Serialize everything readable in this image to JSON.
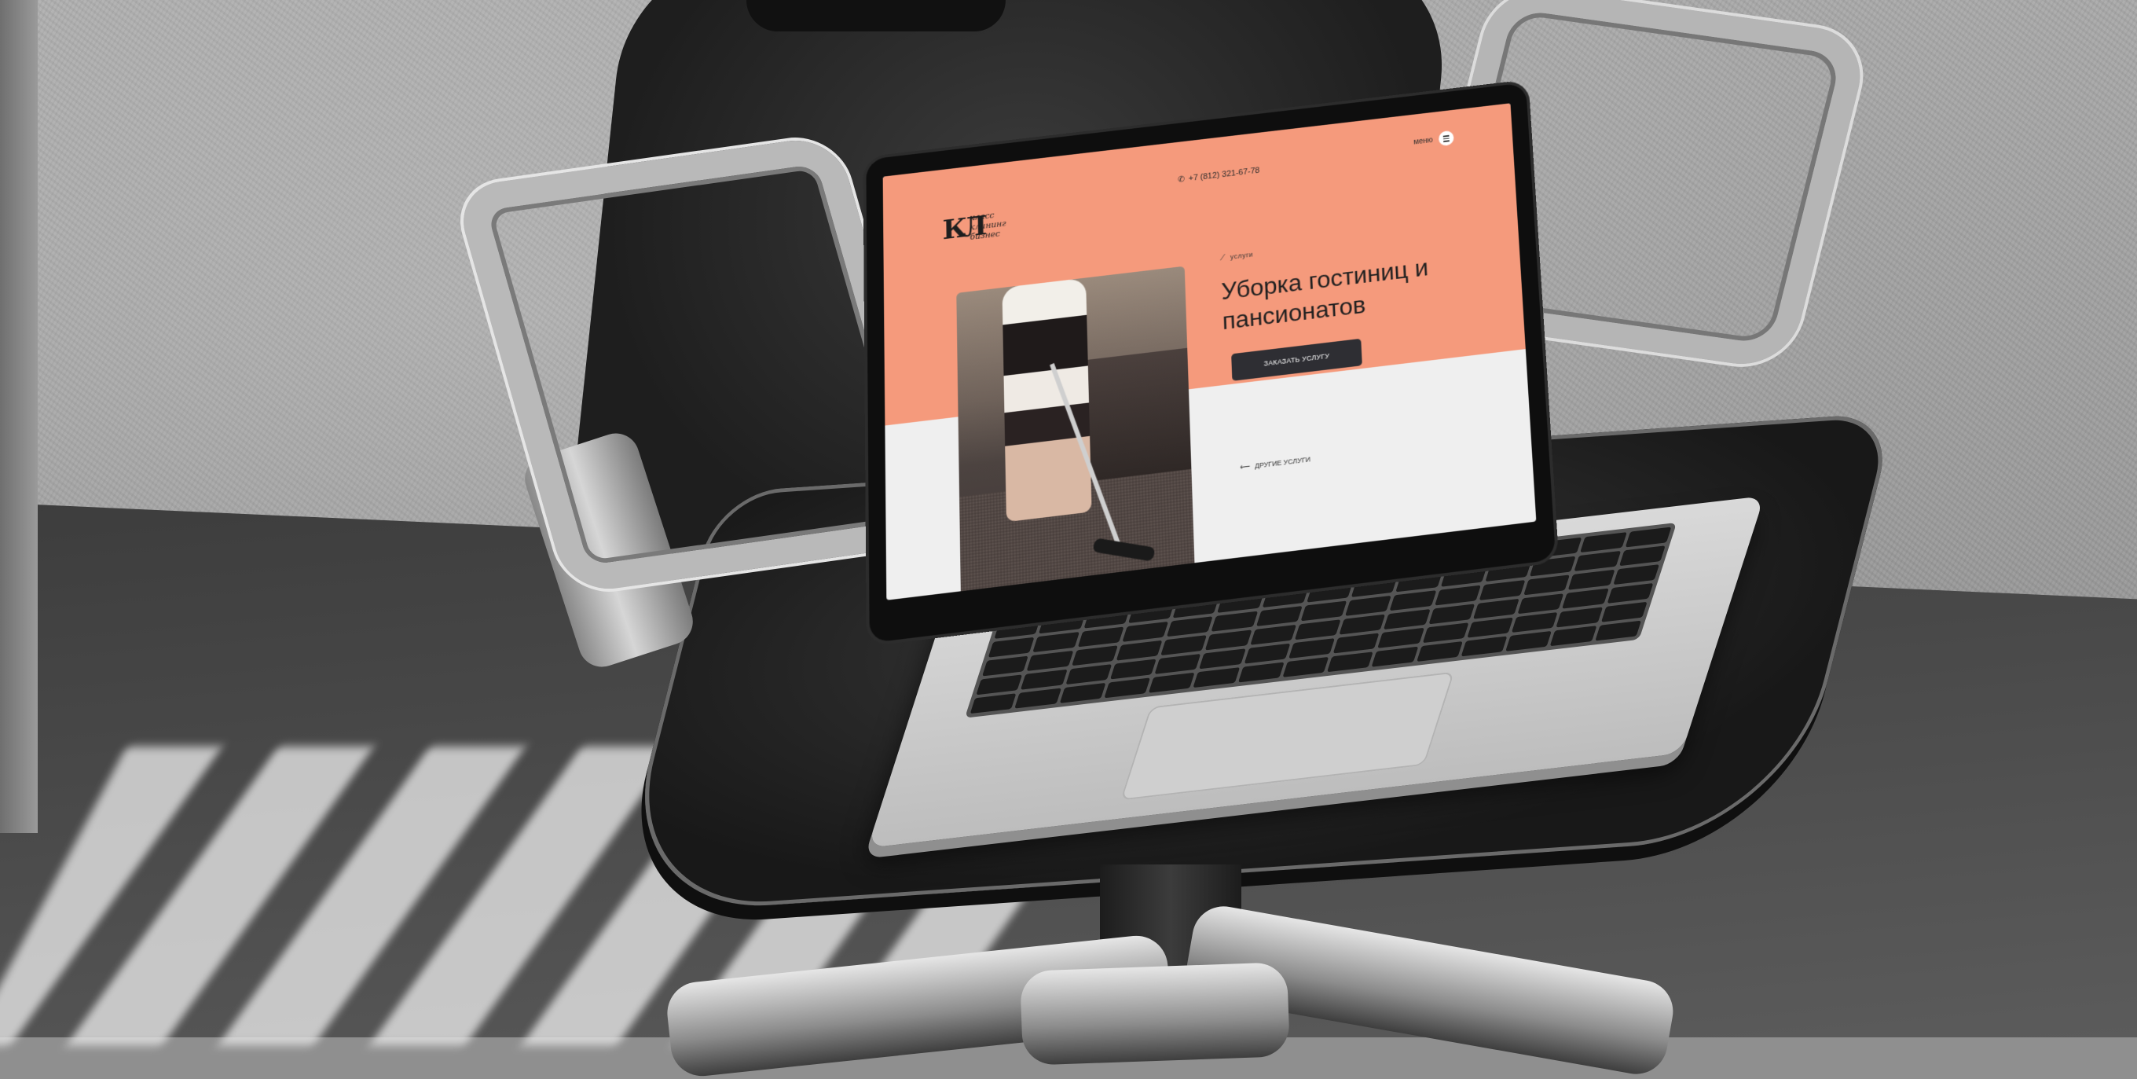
{
  "site": {
    "logo": {
      "mark": "КЛ",
      "line1": "класс",
      "line2": "клининг",
      "line3": "бизнес"
    },
    "phone": "+7 (812) 321-67-78",
    "menu_label": "меню",
    "section_tag": "услуги",
    "headline": "Уборка гостиниц и пансионатов",
    "order_button": "ЗАКАЗАТЬ УСЛУГУ",
    "other_services_link": "ДРУГИЕ УСЛУГИ"
  },
  "colors": {
    "accent": "#f59a7c",
    "button": "#2e2e33",
    "screen_background": "#efefef"
  },
  "icons": {
    "phone": "phone-icon",
    "menu": "hamburger-icon",
    "back_arrow": "arrow-left-icon",
    "sparkle": "sparkle-icon"
  }
}
